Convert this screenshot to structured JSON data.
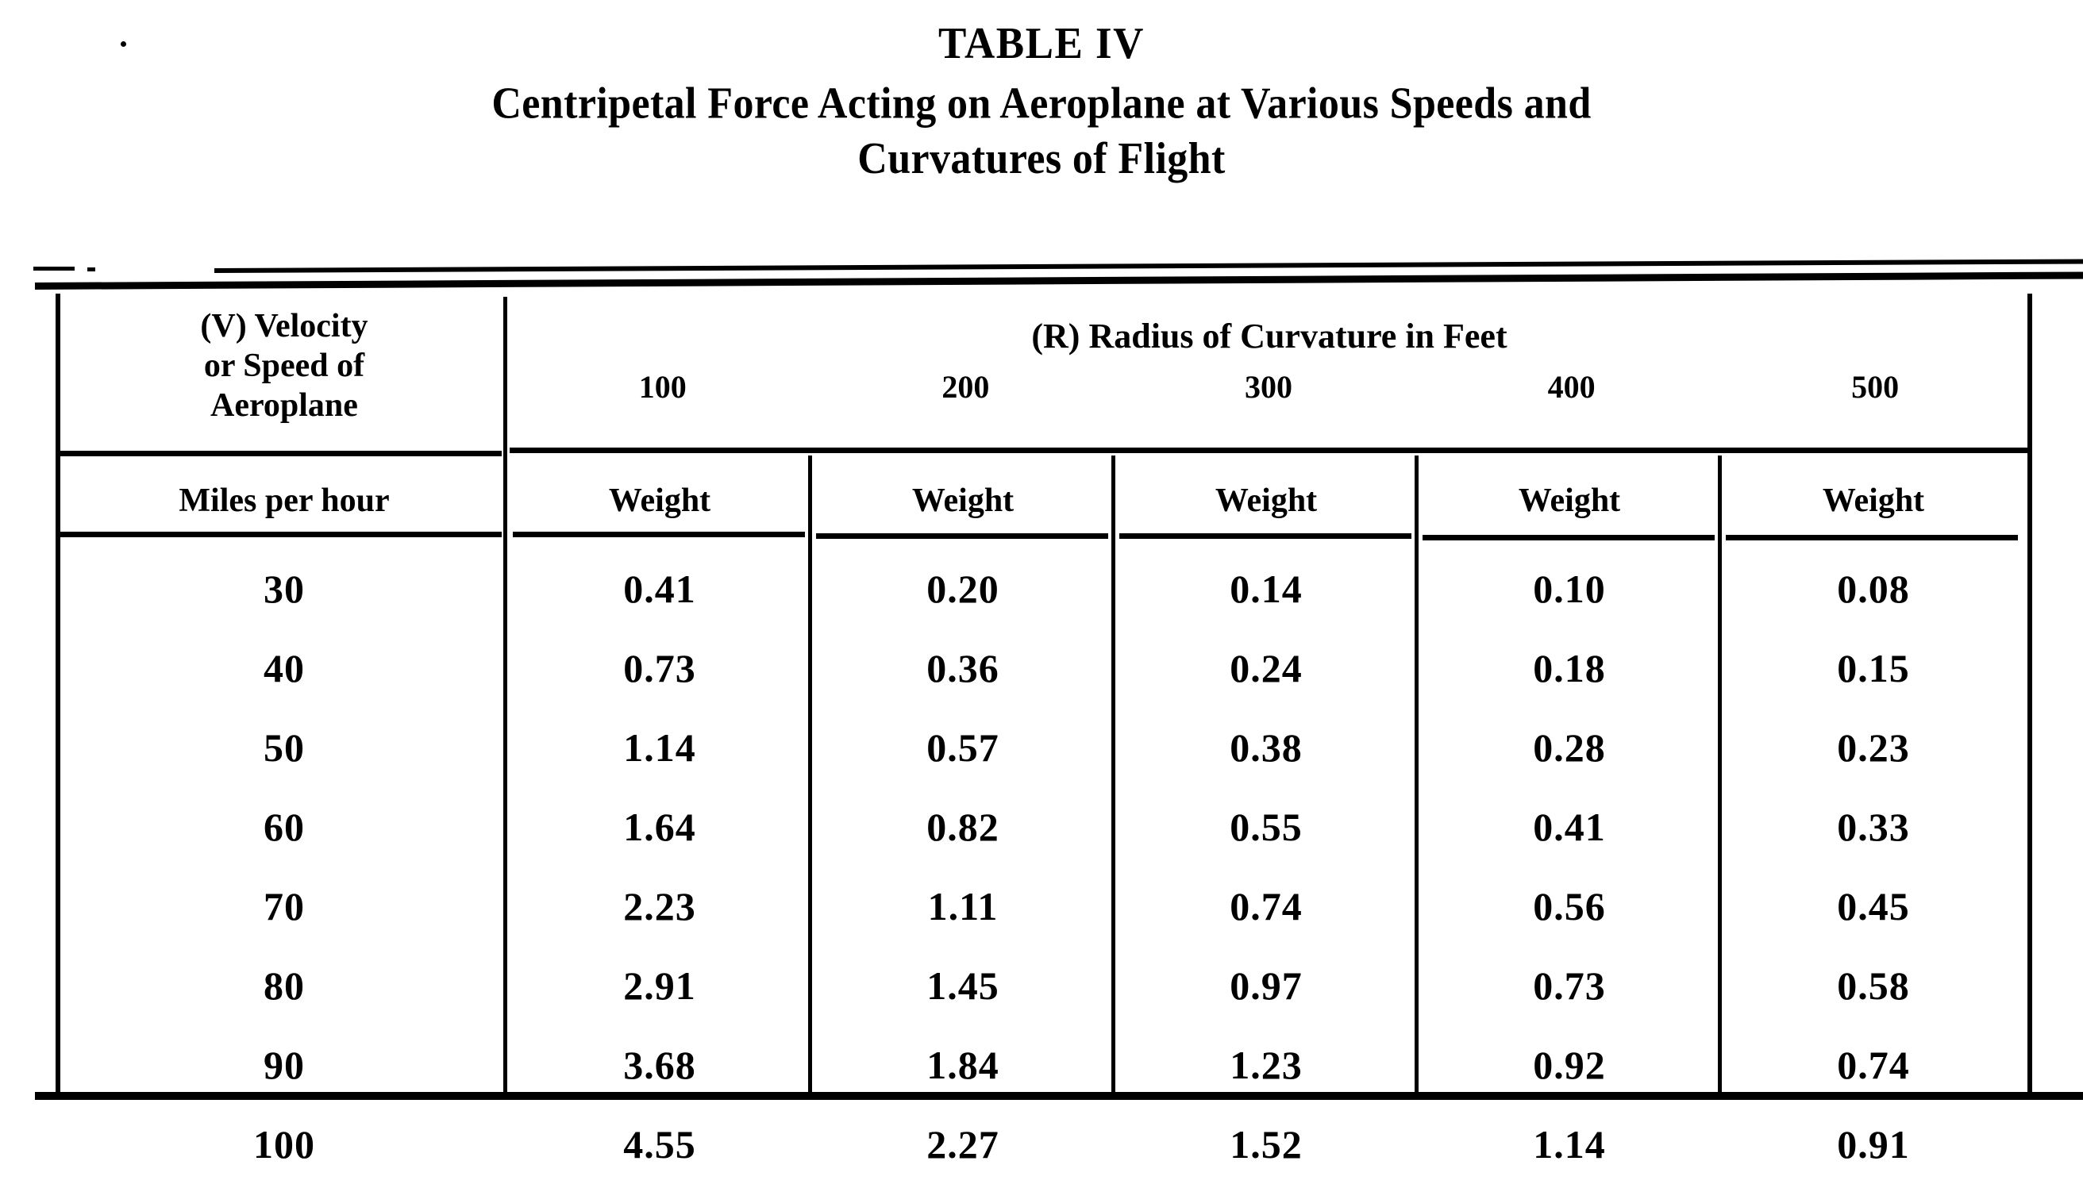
{
  "document": {
    "table_number": "TABLE IV",
    "caption_line1": "Centripetal Force Acting on Aeroplane at Various Speeds and",
    "caption_line2": "Curvatures of Flight",
    "ink_color": "#000000",
    "paper_color": "#ffffff"
  },
  "table": {
    "row_header": {
      "line1": "(V)  Velocity",
      "line2": "or Speed of",
      "line3": "Aeroplane"
    },
    "col_group_header": "(R)   Radius of Curvature in Feet",
    "radius_values": [
      "100",
      "200",
      "300",
      "400",
      "500"
    ],
    "unit_row": [
      "Miles per  hour",
      "Weight",
      "Weight",
      "Weight",
      "Weight",
      "Weight"
    ],
    "rows": [
      {
        "speed": "30",
        "weights": [
          "0.41",
          "0.20",
          "0.14",
          "0.10",
          "0.08"
        ]
      },
      {
        "speed": "40",
        "weights": [
          "0.73",
          "0.36",
          "0.24",
          "0.18",
          "0.15"
        ]
      },
      {
        "speed": "50",
        "weights": [
          "1.14",
          "0.57",
          "0.38",
          "0.28",
          "0.23"
        ]
      },
      {
        "speed": "60",
        "weights": [
          "1.64",
          "0.82",
          "0.55",
          "0.41",
          "0.33"
        ]
      },
      {
        "speed": "70",
        "weights": [
          "2.23",
          "1.11",
          "0.74",
          "0.56",
          "0.45"
        ]
      },
      {
        "speed": "80",
        "weights": [
          "2.91",
          "1.45",
          "0.97",
          "0.73",
          "0.58"
        ]
      },
      {
        "speed": "90",
        "weights": [
          "3.68",
          "1.84",
          "1.23",
          "0.92",
          "0.74"
        ]
      },
      {
        "speed": "100",
        "weights": [
          "4.55",
          "2.27",
          "1.52",
          "1.14",
          "0.91"
        ]
      }
    ]
  },
  "chart_data": {
    "type": "table",
    "title": "Centripetal Force Acting on Aeroplane at Various Speeds and Curvatures of Flight",
    "xlabel": "(R)   Radius of Curvature in Feet",
    "ylabel": "(V)  Velocity or Speed of Aeroplane",
    "row_unit": "Miles per  hour",
    "cell_unit": "Weight",
    "categories": [
      "100",
      "200",
      "300",
      "400",
      "500"
    ],
    "x": [
      30,
      40,
      50,
      60,
      70,
      80,
      90,
      100
    ],
    "series": [
      {
        "name": "100",
        "values": [
          0.41,
          0.73,
          1.14,
          1.64,
          2.23,
          2.91,
          3.68,
          4.55
        ]
      },
      {
        "name": "200",
        "values": [
          0.2,
          0.36,
          0.57,
          0.82,
          1.11,
          1.45,
          1.84,
          2.27
        ]
      },
      {
        "name": "300",
        "values": [
          0.14,
          0.24,
          0.38,
          0.55,
          0.74,
          0.97,
          1.23,
          1.52
        ]
      },
      {
        "name": "400",
        "values": [
          0.1,
          0.18,
          0.28,
          0.41,
          0.56,
          0.73,
          0.92,
          1.14
        ]
      },
      {
        "name": "500",
        "values": [
          0.08,
          0.15,
          0.23,
          0.33,
          0.45,
          0.58,
          0.74,
          0.91
        ]
      }
    ],
    "grid": true,
    "legend": "none"
  }
}
